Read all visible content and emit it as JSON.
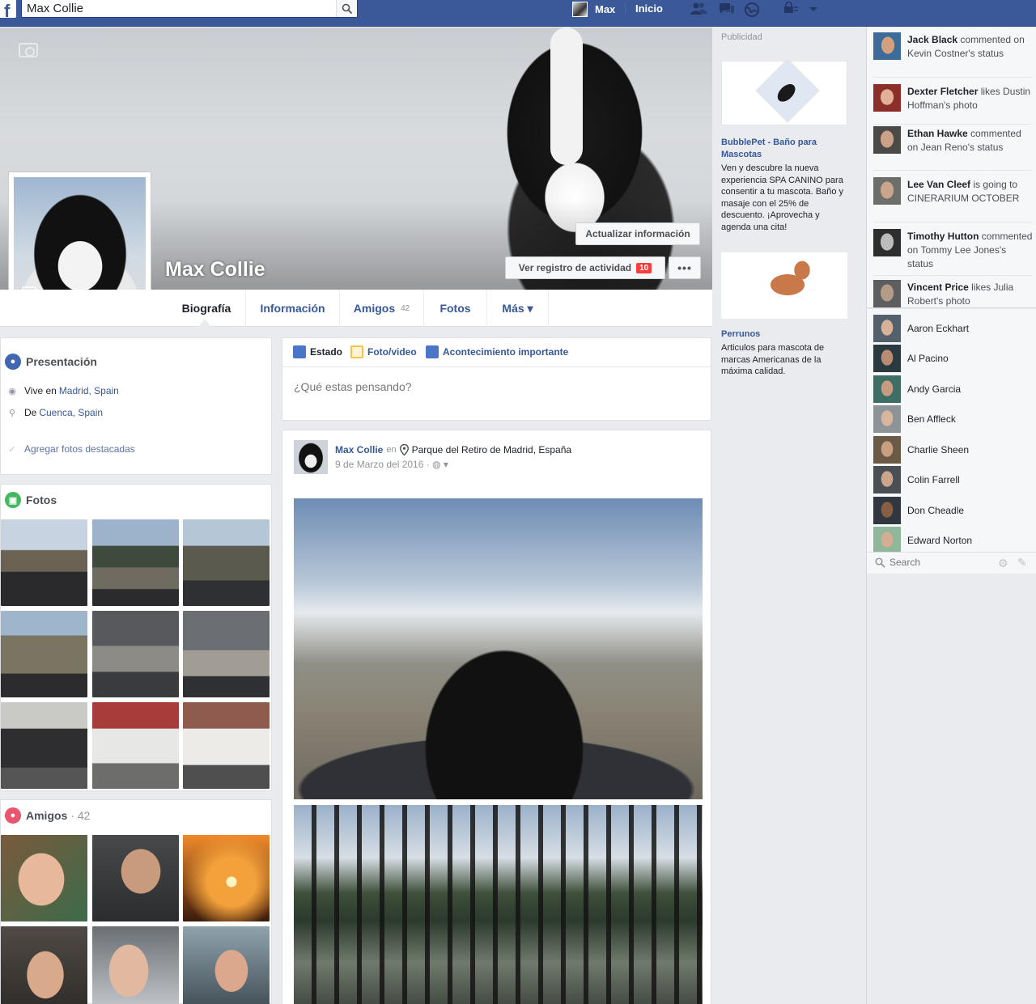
{
  "topbar": {
    "search_value": "Max Collie",
    "user_name": "Max",
    "home_label": "Inicio"
  },
  "profile": {
    "name": "Max Collie",
    "update_info_label": "Actualizar información",
    "activity_label": "Ver registro de actividad",
    "activity_badge": "10",
    "more_label": "•••"
  },
  "tabs": [
    {
      "label": "Biografía"
    },
    {
      "label": "Información"
    },
    {
      "label": "Amigos",
      "count": "42"
    },
    {
      "label": "Fotos"
    },
    {
      "label": "Más ▾"
    }
  ],
  "intro": {
    "title": "Presentación",
    "lives_prefix": "Vive en",
    "lives_place": "Madrid, Spain",
    "from_prefix": "De",
    "from_place": "Cuenca, Spain",
    "add_featured": "Agregar fotos destacadas"
  },
  "photos": {
    "title": "Fotos"
  },
  "friends": {
    "title": "Amigos",
    "count": "· 42"
  },
  "composer": {
    "tab_status": "Estado",
    "tab_photo": "Foto/video",
    "tab_event": "Acontecimiento importante",
    "placeholder": "¿Qué estas pensando?"
  },
  "post": {
    "author": "Max Collie",
    "at_word": "en",
    "place": "Parque del Retiro de Madrid, España",
    "date": "9 de Marzo del 2016 ·"
  },
  "ads": {
    "label": "Publicidad",
    "items": [
      {
        "title": "BubblePet - Baño para Mascotas",
        "text": "Ven y descubre la nueva experiencia SPA CANINO para consentir a tu mascota. Baño y masaje con el 25% de descuento. ¡Aprovecha y agenda una cita!"
      },
      {
        "title": "Perrunos",
        "text": "Articulos para mascota de marcas Americanas de la máxima calidad."
      }
    ]
  },
  "ticker": [
    {
      "name": "Jack Black",
      "action": "commented on Kevin Costner's status"
    },
    {
      "name": "Dexter Fletcher",
      "action": "likes Dustin Hoffman's photo"
    },
    {
      "name": "Ethan Hawke",
      "action": "commented on Jean Reno's status"
    },
    {
      "name": "Lee Van Cleef",
      "action": "is going to CINERARIUM OCTOBER"
    },
    {
      "name": "Timothy Hutton",
      "action": "commented on Tommy Lee Jones's status"
    },
    {
      "name": "Vincent Price",
      "action": "likes Julia Robert's photo"
    }
  ],
  "chat": {
    "contacts": [
      "Aaron Eckhart",
      "Al Pacino",
      "Andy Garcia",
      "Ben Affleck",
      "Charlie Sheen",
      "Colin Farrell",
      "Don Cheadle",
      "Edward Norton"
    ],
    "search_placeholder": "Search"
  }
}
